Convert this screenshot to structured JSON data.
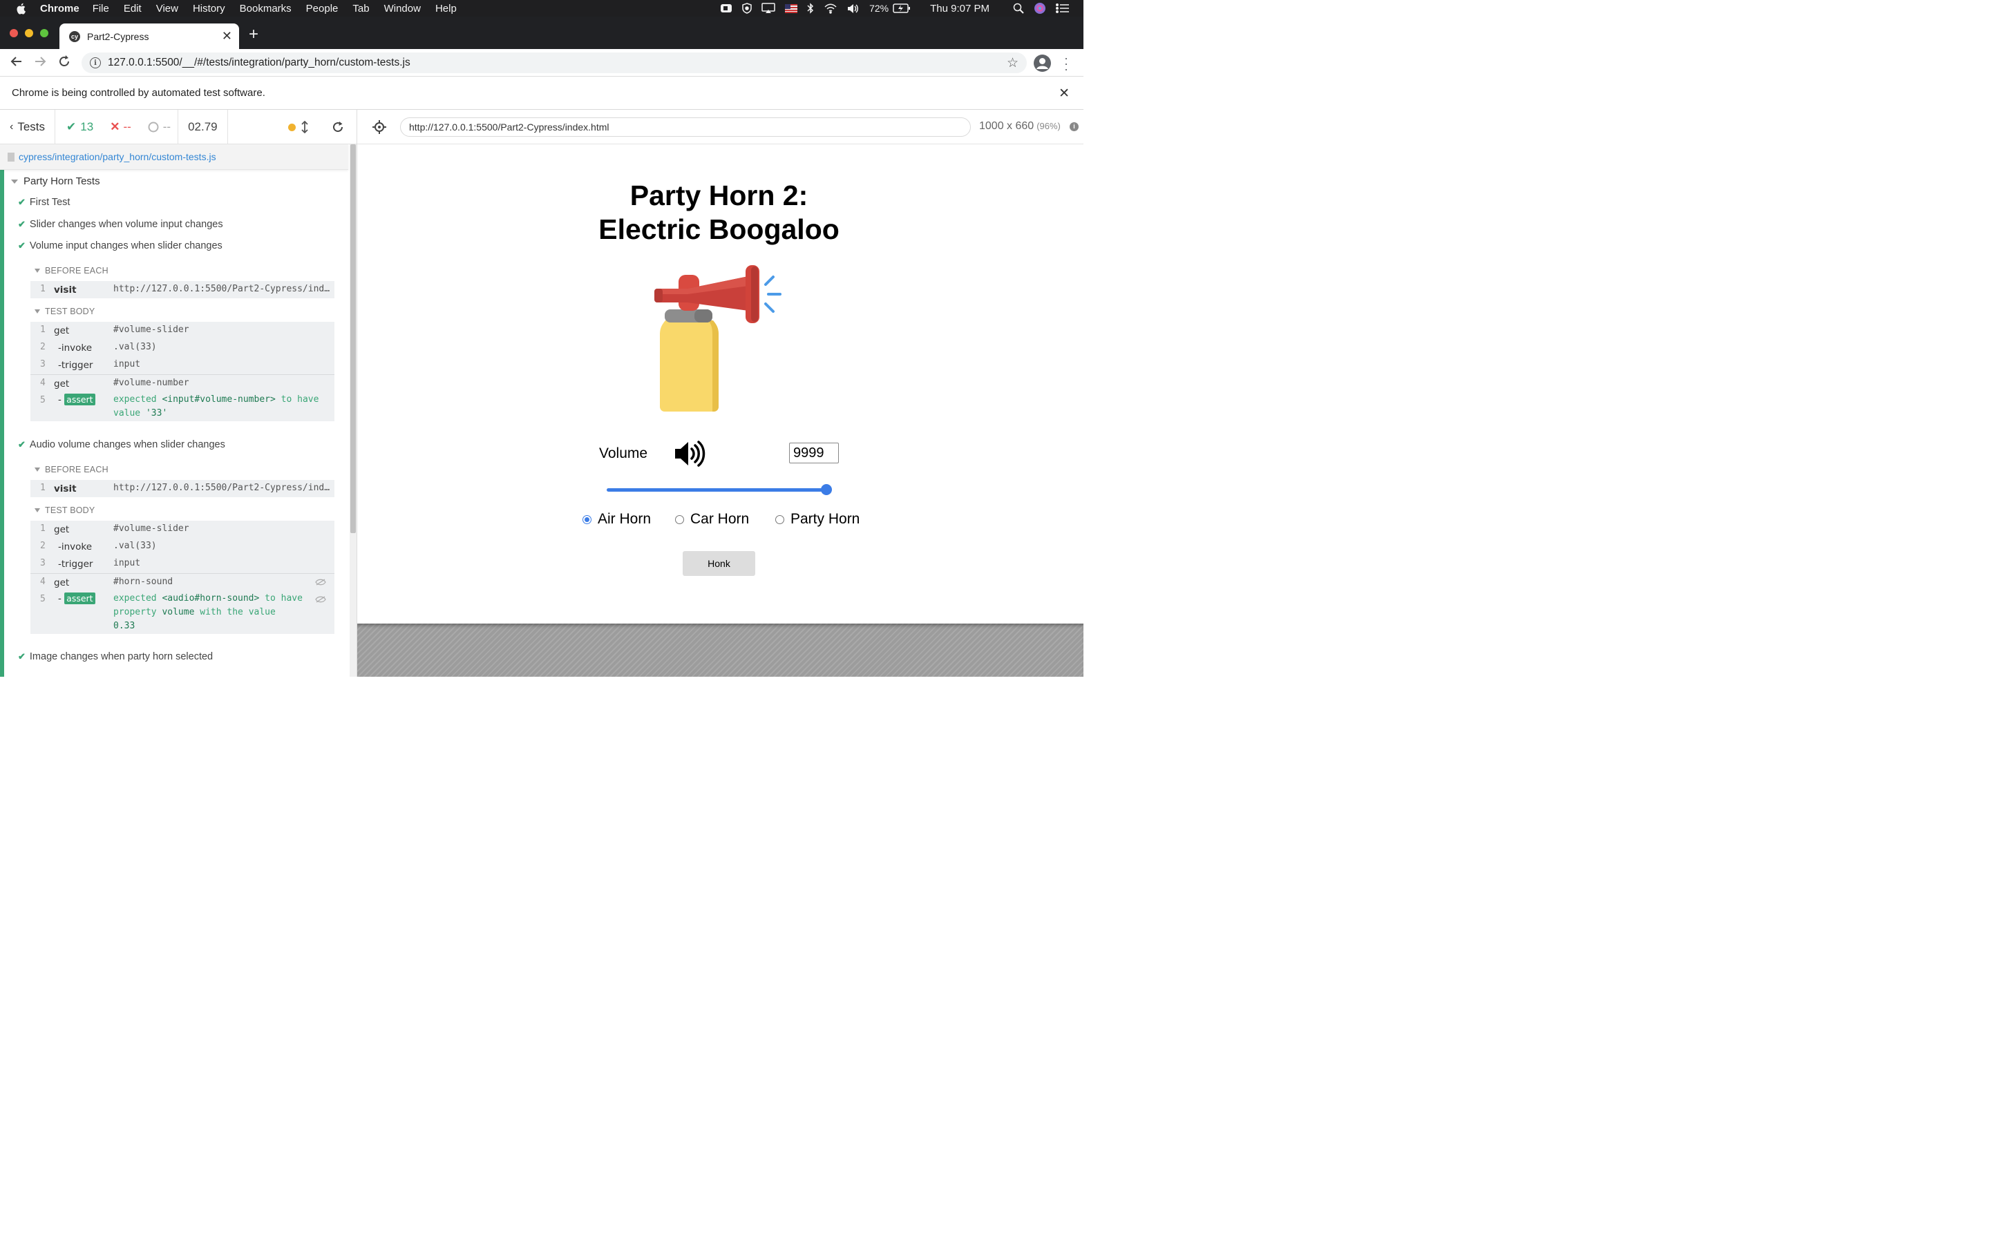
{
  "menubar": {
    "app": "Chrome",
    "items": [
      "File",
      "Edit",
      "View",
      "History",
      "Bookmarks",
      "People",
      "Tab",
      "Window",
      "Help"
    ],
    "battery": "72%",
    "clock": "Thu 9:07 PM"
  },
  "browser": {
    "tab_title": "Part2-Cypress",
    "url": "127.0.0.1:5500/__/#/tests/integration/party_horn/custom-tests.js",
    "infobar": "Chrome is being controlled by automated test software."
  },
  "reporter": {
    "tests_label": "Tests",
    "passed": "13",
    "failed": "--",
    "pending": "--",
    "duration": "02.79",
    "spec_path": "cypress/integration/party_horn/custom-tests.js",
    "suite_title": "Party Horn Tests",
    "tests": [
      "First Test",
      "Slider changes when volume input changes",
      "Volume input changes when slider changes",
      "Audio volume changes when slider changes",
      "Image changes when party horn selected"
    ],
    "hooks": {
      "before_each": "BEFORE EACH",
      "test_body": "TEST BODY"
    },
    "test3": {
      "before": [
        {
          "num": "1",
          "name": "visit",
          "msg": "http://127.0.0.1:5500/Part2-Cypress/ind…"
        }
      ],
      "body": [
        {
          "num": "1",
          "name": "get",
          "msg": "#volume-slider"
        },
        {
          "num": "2",
          "name": "-invoke",
          "msg": ".val(33)"
        },
        {
          "num": "3",
          "name": "-trigger",
          "msg": "input"
        },
        {
          "num": "4",
          "name": "get",
          "msg": "#volume-number"
        },
        {
          "num": "5",
          "name": "assert",
          "msg_parts": [
            "expected",
            "<input#volume-number>",
            "to have",
            "value",
            "'33'"
          ]
        }
      ]
    },
    "test4": {
      "before": [
        {
          "num": "1",
          "name": "visit",
          "msg": "http://127.0.0.1:5500/Part2-Cypress/ind…"
        }
      ],
      "body": [
        {
          "num": "1",
          "name": "get",
          "msg": "#volume-slider"
        },
        {
          "num": "2",
          "name": "-invoke",
          "msg": ".val(33)"
        },
        {
          "num": "3",
          "name": "-trigger",
          "msg": "input"
        },
        {
          "num": "4",
          "name": "get",
          "msg": "#horn-sound"
        },
        {
          "num": "5",
          "name": "assert",
          "msg_parts": [
            "expected",
            "<audio#horn-sound>",
            "to have",
            "property",
            "volume",
            "with the value",
            "0.33"
          ]
        }
      ]
    }
  },
  "runner": {
    "aut_url": "http://127.0.0.1:5500/Part2-Cypress/index.html",
    "viewport": "1000 x 660",
    "scale": "(96%)"
  },
  "app": {
    "title_line1": "Party Horn 2:",
    "title_line2": "Electric Boogaloo",
    "volume_label": "Volume",
    "volume_value": "9999",
    "slider_fraction": 1.0,
    "radios": [
      {
        "label": "Air Horn",
        "checked": true
      },
      {
        "label": "Car Horn",
        "checked": false
      },
      {
        "label": "Party Horn",
        "checked": false
      }
    ],
    "honk_label": "Honk"
  }
}
